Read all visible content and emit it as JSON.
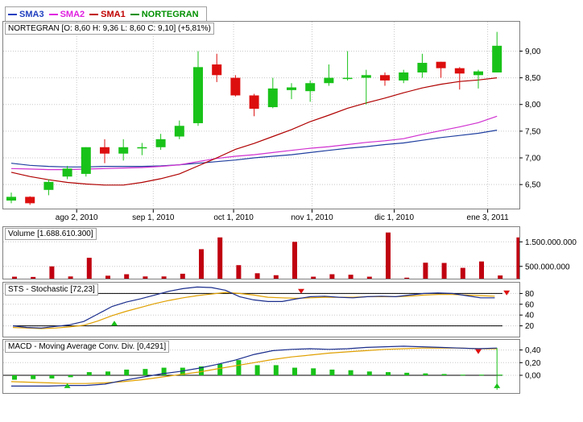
{
  "legend": [
    {
      "label": "SMA3",
      "color": "#1f3fbf"
    },
    {
      "label": "SMA2",
      "color": "#e020e0"
    },
    {
      "label": "SMA1",
      "color": "#c00000"
    },
    {
      "label": "NORTEGRAN",
      "color": "#009000"
    }
  ],
  "colors": {
    "up": "#19c219",
    "down": "#dd0e0e",
    "sma3": "#1f3f9f",
    "sma2": "#d030d0",
    "sma1": "#b00000",
    "volume": "#c00010",
    "stoch_k": "#1a2d8c",
    "stoch_d": "#e0a000",
    "macd": "#1a2d8c",
    "signal": "#e0a000",
    "hist": "#19c219"
  },
  "chart_data": [
    {
      "type": "candlestick",
      "title": "NORTEGRAN [O: 8,60  H: 9,36  L: 8,60  C: 9,10] (+5,81%)",
      "ylim": [
        6.05,
        9.55
      ],
      "yticks": [
        {
          "v": 6.5,
          "label": "6,50"
        },
        {
          "v": 7.0,
          "label": "7,00"
        },
        {
          "v": 7.5,
          "label": "7,50"
        },
        {
          "v": 8.0,
          "label": "8,00"
        },
        {
          "v": 8.5,
          "label": "8,50"
        },
        {
          "v": 9.0,
          "label": "9,00"
        }
      ],
      "xticks": [
        {
          "i": 3.5,
          "label": "ago 2, 2010"
        },
        {
          "i": 7.6,
          "label": "sep 1, 2010"
        },
        {
          "i": 11.9,
          "label": "oct 1, 2010"
        },
        {
          "i": 16.1,
          "label": "nov 1, 2010"
        },
        {
          "i": 20.5,
          "label": "dic 1, 2010"
        },
        {
          "i": 25.5,
          "label": "ene 3, 2011"
        }
      ],
      "candles": [
        {
          "o": 6.2,
          "h": 6.35,
          "l": 6.15,
          "c": 6.27
        },
        {
          "o": 6.27,
          "h": 6.28,
          "l": 6.12,
          "c": 6.15
        },
        {
          "o": 6.4,
          "h": 6.6,
          "l": 6.3,
          "c": 6.55
        },
        {
          "o": 6.65,
          "h": 6.85,
          "l": 6.6,
          "c": 6.8
        },
        {
          "o": 6.7,
          "h": 7.2,
          "l": 6.65,
          "c": 7.2
        },
        {
          "o": 7.2,
          "h": 7.35,
          "l": 6.9,
          "c": 7.08
        },
        {
          "o": 7.08,
          "h": 7.35,
          "l": 6.95,
          "c": 7.2
        },
        {
          "o": 7.2,
          "h": 7.28,
          "l": 7.05,
          "c": 7.2
        },
        {
          "o": 7.2,
          "h": 7.45,
          "l": 7.15,
          "c": 7.35
        },
        {
          "o": 7.4,
          "h": 7.7,
          "l": 7.35,
          "c": 7.6
        },
        {
          "o": 7.65,
          "h": 9.0,
          "l": 7.6,
          "c": 8.7
        },
        {
          "o": 8.75,
          "h": 8.95,
          "l": 8.42,
          "c": 8.55
        },
        {
          "o": 8.5,
          "h": 8.55,
          "l": 8.15,
          "c": 8.17
        },
        {
          "o": 8.17,
          "h": 8.2,
          "l": 7.78,
          "c": 7.92
        },
        {
          "o": 7.95,
          "h": 8.5,
          "l": 7.93,
          "c": 8.3
        },
        {
          "o": 8.27,
          "h": 8.4,
          "l": 8.1,
          "c": 8.32
        },
        {
          "o": 8.25,
          "h": 8.45,
          "l": 8.05,
          "c": 8.4
        },
        {
          "o": 8.4,
          "h": 8.75,
          "l": 8.35,
          "c": 8.5
        },
        {
          "o": 8.5,
          "h": 9.0,
          "l": 8.45,
          "c": 8.5
        },
        {
          "o": 8.5,
          "h": 8.65,
          "l": 8.0,
          "c": 8.55
        },
        {
          "o": 8.55,
          "h": 8.6,
          "l": 8.35,
          "c": 8.45
        },
        {
          "o": 8.45,
          "h": 8.65,
          "l": 8.4,
          "c": 8.6
        },
        {
          "o": 8.6,
          "h": 8.95,
          "l": 8.5,
          "c": 8.78
        },
        {
          "o": 8.8,
          "h": 8.8,
          "l": 8.5,
          "c": 8.68
        },
        {
          "o": 8.68,
          "h": 8.7,
          "l": 8.28,
          "c": 8.58
        },
        {
          "o": 8.55,
          "h": 8.65,
          "l": 8.3,
          "c": 8.62
        },
        {
          "o": 8.6,
          "h": 9.36,
          "l": 8.6,
          "c": 9.1
        }
      ],
      "sma3": [
        6.9,
        6.86,
        6.84,
        6.83,
        6.83,
        6.84,
        6.84,
        6.84,
        6.85,
        6.87,
        6.9,
        6.93,
        6.96,
        7.0,
        7.03,
        7.06,
        7.1,
        7.14,
        7.18,
        7.21,
        7.25,
        7.28,
        7.33,
        7.38,
        7.42,
        7.46,
        7.52
      ],
      "sma2": [
        6.8,
        6.79,
        6.78,
        6.78,
        6.79,
        6.8,
        6.81,
        6.82,
        6.84,
        6.87,
        6.93,
        6.99,
        7.03,
        7.06,
        7.1,
        7.14,
        7.18,
        7.21,
        7.25,
        7.29,
        7.32,
        7.36,
        7.44,
        7.51,
        7.58,
        7.66,
        7.78
      ],
      "sma1": [
        6.73,
        6.65,
        6.59,
        6.54,
        6.51,
        6.49,
        6.49,
        6.54,
        6.61,
        6.7,
        6.85,
        7.0,
        7.16,
        7.27,
        7.4,
        7.53,
        7.68,
        7.8,
        7.93,
        8.03,
        8.12,
        8.22,
        8.31,
        8.38,
        8.43,
        8.46,
        8.5
      ]
    },
    {
      "type": "bar",
      "title": "Volume [1.688.610.300]",
      "ylim": [
        0,
        2100000000
      ],
      "yticks": [
        {
          "v": 500000000,
          "label": "500.000.000"
        },
        {
          "v": 1500000000,
          "label": "1.500.000.000"
        }
      ],
      "values": [
        80000000,
        70000000,
        500000000,
        90000000,
        850000000,
        120000000,
        180000000,
        90000000,
        90000000,
        200000000,
        1200000000,
        1680000000,
        550000000,
        220000000,
        140000000,
        1500000000,
        80000000,
        180000000,
        160000000,
        80000000,
        1880000000,
        40000000,
        650000000,
        640000000,
        440000000,
        700000000,
        130000000,
        1680000000
      ]
    },
    {
      "type": "line",
      "title": "STS - Stochastic [72,23]",
      "ylim": [
        0,
        100
      ],
      "yticks": [
        {
          "v": 20,
          "label": "20"
        },
        {
          "v": 40,
          "label": "40"
        },
        {
          "v": 60,
          "label": "60"
        },
        {
          "v": 80,
          "label": "80"
        }
      ],
      "k": [
        20,
        17,
        16,
        19,
        22,
        28,
        42,
        56,
        64,
        70,
        77,
        84,
        89,
        92,
        91,
        86,
        74,
        68,
        65,
        65,
        70,
        74,
        75,
        73,
        72,
        74,
        75,
        74,
        77,
        80,
        81,
        80,
        76,
        72,
        72
      ],
      "d": [
        17,
        16,
        15,
        16,
        18,
        21,
        29,
        39,
        47,
        54,
        61,
        67,
        72,
        76,
        79,
        82,
        80,
        77,
        73,
        72,
        71,
        72,
        73,
        73,
        73,
        74,
        74,
        74,
        75,
        77,
        78,
        78,
        77,
        76,
        75
      ],
      "markers": [
        {
          "i": 5,
          "v": 22,
          "dir": "up"
        },
        {
          "i": 15,
          "v": 87,
          "dir": "down"
        },
        {
          "i": 26,
          "v": 84,
          "dir": "down"
        }
      ]
    },
    {
      "type": "line",
      "title": "MACD - Moving Average Conv. Div. [0,4291]",
      "ylim": [
        -0.28,
        0.56
      ],
      "yticks": [
        {
          "v": 0.0,
          "label": "0,00"
        },
        {
          "v": 0.2,
          "label": "0,20"
        },
        {
          "v": 0.4,
          "label": "0,40"
        }
      ],
      "macd": [
        -0.17,
        -0.17,
        -0.17,
        -0.16,
        -0.16,
        -0.14,
        -0.08,
        -0.03,
        0.02,
        0.06,
        0.11,
        0.17,
        0.24,
        0.33,
        0.39,
        0.41,
        0.42,
        0.41,
        0.42,
        0.44,
        0.45,
        0.46,
        0.45,
        0.44,
        0.43,
        0.42,
        0.43
      ],
      "signal": [
        -0.1,
        -0.11,
        -0.12,
        -0.13,
        -0.13,
        -0.12,
        -0.1,
        -0.07,
        -0.03,
        0.01,
        0.05,
        0.1,
        0.15,
        0.2,
        0.25,
        0.29,
        0.32,
        0.35,
        0.37,
        0.39,
        0.41,
        0.42,
        0.43,
        0.43,
        0.43,
        0.42,
        0.42
      ],
      "hist": [
        -0.07,
        -0.06,
        -0.05,
        -0.03,
        0.05,
        0.06,
        0.09,
        0.1,
        0.12,
        0.12,
        0.14,
        0.18,
        0.24,
        0.16,
        0.16,
        0.12,
        0.11,
        0.09,
        0.08,
        0.06,
        0.05,
        0.04,
        0.03,
        0.02,
        0.01,
        0.01,
        0.01
      ],
      "markers": [
        {
          "i": 3,
          "v": -0.19,
          "dir": "up"
        },
        {
          "i": 25,
          "v": 0.4,
          "dir": "down"
        },
        {
          "i": 26,
          "v": -0.19,
          "dir": "up"
        }
      ]
    }
  ]
}
